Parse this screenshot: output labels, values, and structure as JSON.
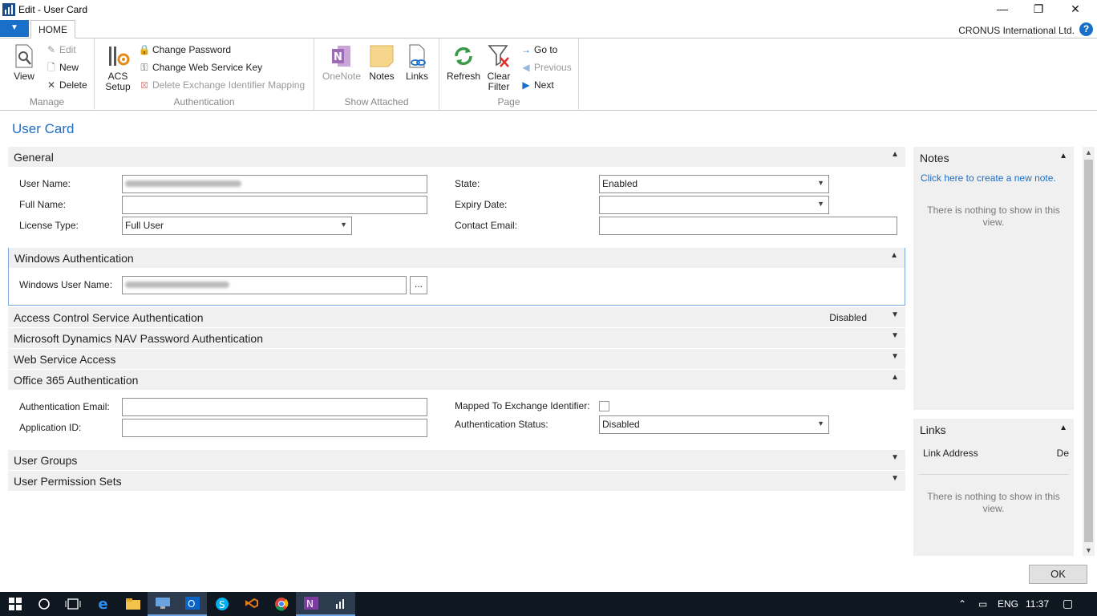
{
  "window": {
    "title": "Edit - User Card",
    "minimize": "—",
    "restore": "❐",
    "close": "✕"
  },
  "ribbon": {
    "tab_home": "HOME",
    "company": "CRONUS International Ltd.",
    "help": "?",
    "manage": {
      "label": "Manage",
      "view": "View",
      "edit": "Edit",
      "new": "New",
      "delete": "Delete"
    },
    "authentication": {
      "label": "Authentication",
      "acs1": "ACS",
      "acs2": "Setup",
      "change_password": "Change Password",
      "change_ws_key": "Change Web Service Key",
      "delete_mapping": "Delete Exchange Identifier Mapping"
    },
    "show_attached": {
      "label": "Show Attached",
      "onenote": "OneNote",
      "notes": "Notes",
      "links": "Links"
    },
    "page": {
      "label": "Page",
      "refresh": "Refresh",
      "clear1": "Clear",
      "clear2": "Filter",
      "goto": "Go to",
      "previous": "Previous",
      "next": "Next"
    }
  },
  "page_title": "User Card",
  "general": {
    "title": "General",
    "user_name_label": "User Name:",
    "full_name_label": "Full Name:",
    "full_name": "",
    "license_type_label": "License Type:",
    "license_type": "Full User",
    "state_label": "State:",
    "state": "Enabled",
    "expiry_label": "Expiry Date:",
    "expiry": "",
    "contact_email_label": "Contact Email:",
    "contact_email": ""
  },
  "windows_auth": {
    "title": "Windows Authentication",
    "user_label": "Windows User Name:",
    "lookup": "..."
  },
  "acs": {
    "title": "Access Control Service Authentication",
    "summary": "Disabled"
  },
  "nav_password": {
    "title": "Microsoft Dynamics NAV Password Authentication"
  },
  "ws_access": {
    "title": "Web Service Access"
  },
  "o365": {
    "title": "Office 365 Authentication",
    "auth_email_label": "Authentication Email:",
    "auth_email": "",
    "app_id_label": "Application ID:",
    "app_id": "",
    "mapped_label": "Mapped To Exchange Identifier:",
    "status_label": "Authentication Status:",
    "status": "Disabled"
  },
  "user_groups": {
    "title": "User Groups"
  },
  "perm_sets": {
    "title": "User Permission Sets"
  },
  "notes": {
    "title": "Notes",
    "link": "Click here to create a new note.",
    "empty": "There is nothing to show in this view."
  },
  "links": {
    "title": "Links",
    "col1": "Link Address",
    "col2": "De",
    "empty": "There is nothing to show in this view."
  },
  "ok": "OK",
  "taskbar": {
    "lang": "ENG",
    "time": "11:37"
  }
}
